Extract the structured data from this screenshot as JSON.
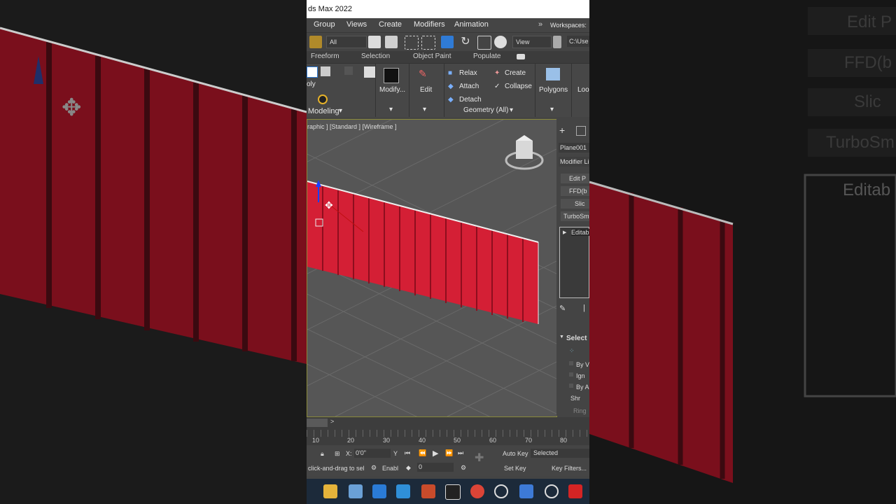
{
  "window": {
    "title": "ds Max 2022"
  },
  "menu": {
    "group": "Group",
    "views": "Views",
    "create": "Create",
    "modifiers": "Modifiers",
    "animation": "Animation",
    "workspaces": "Workspaces:"
  },
  "toolbar": {
    "filter": "All",
    "view": "View",
    "path": "C:\\Use"
  },
  "ribbon_tabs": {
    "freeform": "Freeform",
    "selection": "Selection",
    "object_paint": "Object Paint",
    "populate": "Populate"
  },
  "ribbon": {
    "poly": "oly",
    "modeling": "Modeling",
    "modify": "Modify...",
    "edit": "Edit",
    "relax": "Relax",
    "attach": "Attach",
    "detach": "Detach",
    "create": "Create",
    "collapse": "Collapse",
    "geometry": "Geometry (All)",
    "polygons": "Polygons",
    "loop": "Loo"
  },
  "viewport": {
    "label": "raphic ] [Standard ] [Wireframe ]"
  },
  "command_panel": {
    "object_name": "Plane001",
    "modifier_list": "Modifier Li",
    "stack": [
      "Edit P",
      "FFD(b",
      "Slic",
      "TurboSm"
    ],
    "editable": "Editab",
    "selection": "Select",
    "options": [
      "By V",
      "Ign",
      "By A",
      "Shr",
      "Ring"
    ]
  },
  "timeline": {
    "ticks": [
      "10",
      "20",
      "30",
      "40",
      "50",
      "60",
      "70",
      "80"
    ]
  },
  "status": {
    "x_label": "X:",
    "x_value": "0'0\"",
    "y_label": "Y",
    "hint": "click-and-drag to sel",
    "enable": "Enabl",
    "frame": "0",
    "auto_key": "Auto Key",
    "selected": "Selected",
    "set_key": "Set Key",
    "key_filters": "Key Filters..."
  },
  "background_right": [
    "Edit P",
    "FFD(b",
    "Slic",
    "TurboSm",
    "Editab"
  ],
  "colors": {
    "accent": "#2f7bd6",
    "curtain": "#d41f35",
    "viewport": "#565656",
    "grid": "#6a6a6a"
  }
}
